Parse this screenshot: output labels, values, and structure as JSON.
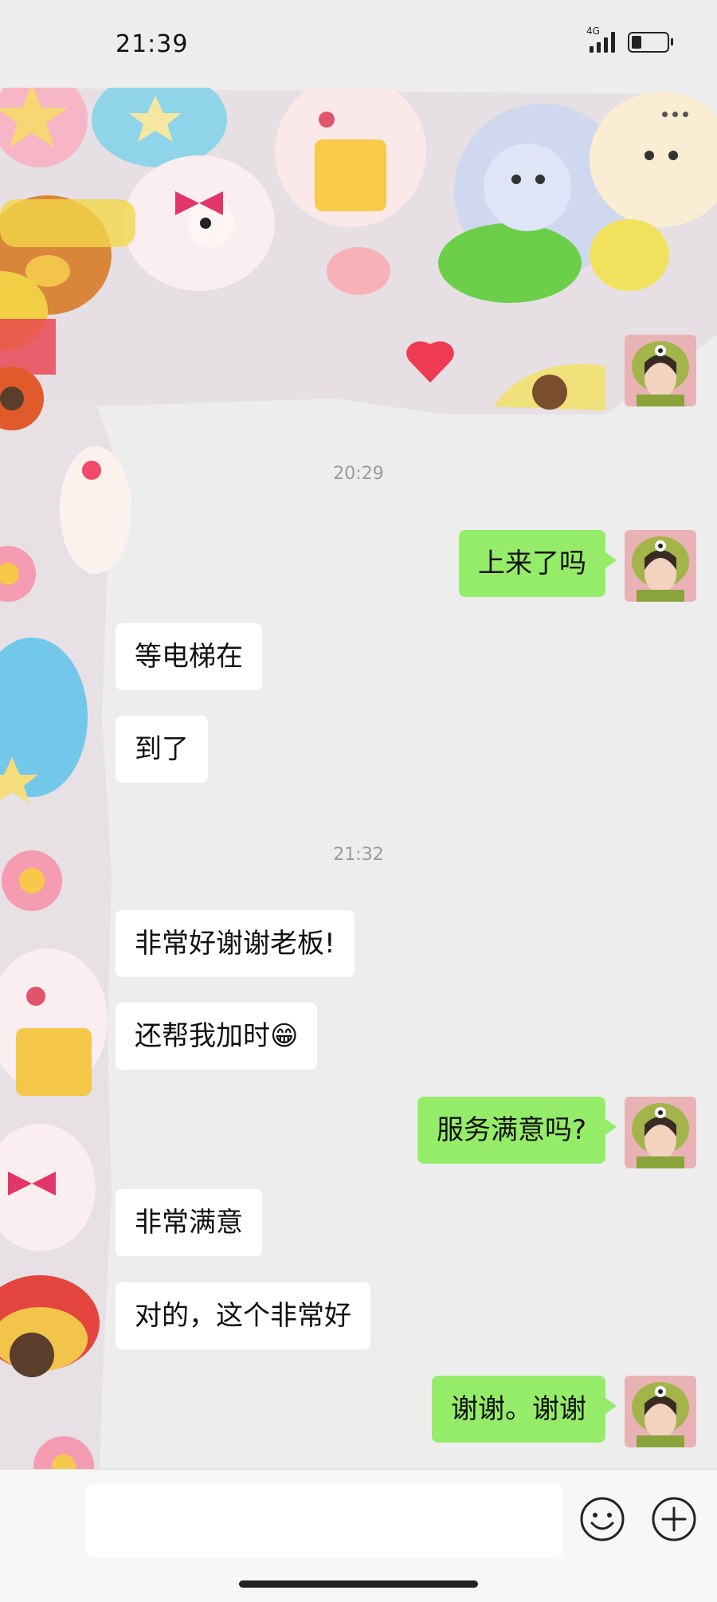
{
  "status_bar": {
    "time": "21:39",
    "network": "4G"
  },
  "timestamps": [
    "20:29",
    "21:32"
  ],
  "messages": [
    {
      "side": "out",
      "text": "上来了吗"
    },
    {
      "side": "in",
      "text": "等电梯在"
    },
    {
      "side": "in",
      "text": "到了"
    },
    {
      "side": "in",
      "text": "非常好谢谢老板!"
    },
    {
      "side": "in",
      "text": "还帮我加时😁"
    },
    {
      "side": "out",
      "text": "服务满意吗?"
    },
    {
      "side": "in",
      "text": "非常满意"
    },
    {
      "side": "in",
      "text": "对的，这个非常好"
    },
    {
      "side": "out",
      "text": "谢谢。谢谢"
    }
  ],
  "input": {
    "value": "",
    "placeholder": ""
  },
  "icons": {
    "more": "more-icon",
    "emoji": "emoji-icon",
    "plus": "plus-icon"
  },
  "colors": {
    "outgoing_bubble": "#95ec69",
    "incoming_bubble": "#ffffff",
    "background": "#ededed"
  }
}
